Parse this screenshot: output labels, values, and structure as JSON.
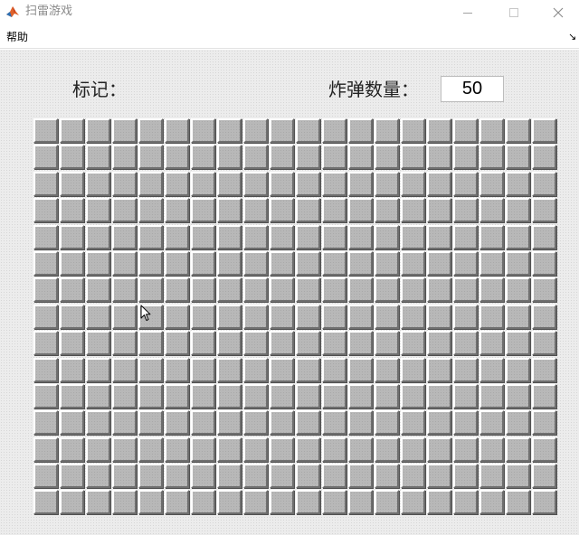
{
  "window": {
    "title": "扫雷游戏",
    "icon": "matlab-logo-icon"
  },
  "menubar": {
    "items": [
      {
        "label": "帮助"
      }
    ],
    "dock_icon": "↘"
  },
  "game": {
    "mark_label": "标记：",
    "bomb_label": "炸弹数量：",
    "bomb_count": "50",
    "grid": {
      "rows": 15,
      "cols": 20,
      "state": "all-unopened"
    }
  },
  "colors": {
    "cell_face": "#b8b8b8",
    "cell_highlight": "#ffffff",
    "cell_shadow": "#6f6f6f",
    "figure_bg": "#ececec"
  }
}
